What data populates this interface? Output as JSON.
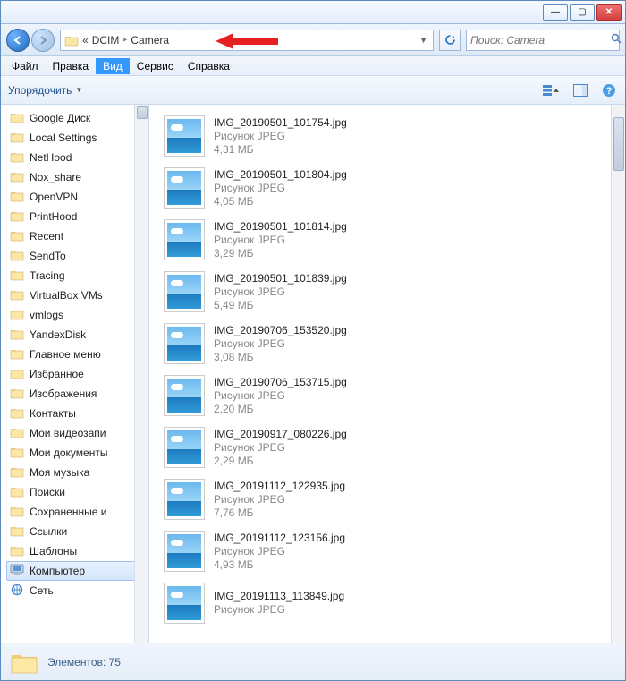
{
  "window": {
    "min_glyph": "—",
    "max_glyph": "▢",
    "close_glyph": "✕"
  },
  "breadcrumb": {
    "root_glyph": "«",
    "parts": [
      "DCIM",
      "Camera"
    ]
  },
  "search": {
    "placeholder": "Поиск: Camera"
  },
  "menu": {
    "file": "Файл",
    "edit": "Правка",
    "view": "Вид",
    "tools": "Сервис",
    "help": "Справка"
  },
  "toolbar": {
    "organize": "Упорядочить"
  },
  "sidebar": {
    "items": [
      {
        "label": "Google Диск"
      },
      {
        "label": "Local Settings"
      },
      {
        "label": "NetHood"
      },
      {
        "label": "Nox_share"
      },
      {
        "label": "OpenVPN"
      },
      {
        "label": "PrintHood"
      },
      {
        "label": "Recent"
      },
      {
        "label": "SendTo"
      },
      {
        "label": "Tracing"
      },
      {
        "label": "VirtualBox VMs"
      },
      {
        "label": "vmlogs"
      },
      {
        "label": "YandexDisk"
      },
      {
        "label": "Главное меню"
      },
      {
        "label": "Избранное"
      },
      {
        "label": "Изображения"
      },
      {
        "label": "Контакты"
      },
      {
        "label": "Мои видеозапи"
      },
      {
        "label": "Мои документы"
      },
      {
        "label": "Моя музыка"
      },
      {
        "label": "Поиски"
      },
      {
        "label": "Сохраненные и"
      },
      {
        "label": "Ссылки"
      },
      {
        "label": "Шаблоны"
      },
      {
        "label": "Компьютер",
        "selected": true,
        "special": "computer"
      },
      {
        "label": "Сеть",
        "special": "network"
      }
    ]
  },
  "files": {
    "type_label": "Рисунок JPEG",
    "items": [
      {
        "name": "IMG_20190501_101754.jpg",
        "size": "4,31 МБ"
      },
      {
        "name": "IMG_20190501_101804.jpg",
        "size": "4,05 МБ"
      },
      {
        "name": "IMG_20190501_101814.jpg",
        "size": "3,29 МБ"
      },
      {
        "name": "IMG_20190501_101839.jpg",
        "size": "5,49 МБ"
      },
      {
        "name": "IMG_20190706_153520.jpg",
        "size": "3,08 МБ"
      },
      {
        "name": "IMG_20190706_153715.jpg",
        "size": "2,20 МБ"
      },
      {
        "name": "IMG_20190917_080226.jpg",
        "size": "2,29 МБ"
      },
      {
        "name": "IMG_20191112_122935.jpg",
        "size": "7,76 МБ"
      },
      {
        "name": "IMG_20191112_123156.jpg",
        "size": "4,93 МБ"
      },
      {
        "name": "IMG_20191113_113849.jpg",
        "size": ""
      }
    ]
  },
  "status": {
    "label": "Элементов:",
    "count": "75"
  }
}
